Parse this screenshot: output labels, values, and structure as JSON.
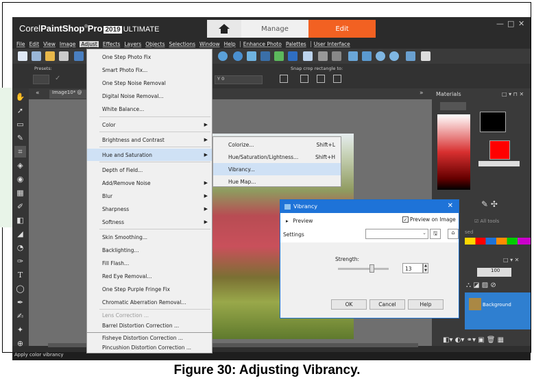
{
  "app": {
    "brand_corel": "Corel",
    "brand_paintshop": "PaintShop",
    "brand_pro": "Pro",
    "brand_year": "2019",
    "brand_edition": "ULTIMATE",
    "tab_manage": "Manage",
    "tab_edit": "Edit"
  },
  "menubar": [
    "File",
    "Edit",
    "View",
    "Image",
    "Adjust",
    "Effects",
    "Layers",
    "Objects",
    "Selections",
    "Window",
    "Help",
    "Enhance Photo",
    "Palettes",
    "User Interface"
  ],
  "toolbar": {
    "presets_label": "Presets:",
    "snap_label": "Snap crop rectangle to:",
    "y_label": "Y",
    "y_value": "0"
  },
  "document": {
    "tab_label": "Image10* @"
  },
  "adjust_menu": {
    "items": [
      {
        "label": "One Step Photo Fix",
        "type": "item"
      },
      {
        "label": "Smart Photo Fix...",
        "type": "item"
      },
      {
        "label": "One Step Noise Removal",
        "type": "item"
      },
      {
        "label": "Digital Noise Removal...",
        "type": "item"
      },
      {
        "label": "White Balance...",
        "type": "item"
      },
      {
        "label": "Color",
        "type": "sub"
      },
      {
        "label": "Brightness and Contrast",
        "type": "sub"
      },
      {
        "label": "Hue and Saturation",
        "type": "sub-active"
      },
      {
        "label": "Depth of Field...",
        "type": "item"
      },
      {
        "label": "Add/Remove Noise",
        "type": "sub"
      },
      {
        "label": "Blur",
        "type": "sub"
      },
      {
        "label": "Sharpness",
        "type": "sub"
      },
      {
        "label": "Softness",
        "type": "sub"
      },
      {
        "label": "Skin Smoothing...",
        "type": "item"
      },
      {
        "label": "Backlighting...",
        "type": "item"
      },
      {
        "label": "Fill Flash...",
        "type": "item"
      },
      {
        "label": "Red Eye Removal...",
        "type": "item"
      },
      {
        "label": "One Step Purple Fringe Fix",
        "type": "item"
      },
      {
        "label": "Chromatic Aberration Removal...",
        "type": "item"
      },
      {
        "label": "Lens Correction ...",
        "type": "disabled"
      },
      {
        "label": "Barrel Distortion Correction ...",
        "type": "item"
      },
      {
        "label": "Fisheye Distortion Correction ...",
        "type": "item"
      },
      {
        "label": "Pincushion Distortion Correction ...",
        "type": "item"
      }
    ]
  },
  "hue_submenu": {
    "items": [
      {
        "label": "Colorize...",
        "shortcut": "Shift+L"
      },
      {
        "label": "Hue/Saturation/Lightness...",
        "shortcut": "Shift+H"
      },
      {
        "label": "Vibrancy...",
        "shortcut": ""
      },
      {
        "label": "Hue Map...",
        "shortcut": ""
      }
    ]
  },
  "dialog": {
    "title": "Vibrancy",
    "preview_label": "Preview",
    "preview_on_image": "Preview on Image",
    "settings_label": "Settings",
    "strength_label": "Strength:",
    "strength_value": "13",
    "ok": "OK",
    "cancel": "Cancel",
    "help": "Help"
  },
  "materials": {
    "title": "Materials",
    "all_tools": "All tools",
    "recently_used": "sed",
    "layer_opacity": "100",
    "layer_name": "Background"
  },
  "status": "Apply color vibrancy",
  "caption": "Figure 30: Adjusting Vibrancy.",
  "colors": {
    "accent": "#f26122",
    "dialog_blue": "#1e73d8",
    "menu_bg": "#f0f0f0",
    "highlight": "#cfe1f5"
  }
}
